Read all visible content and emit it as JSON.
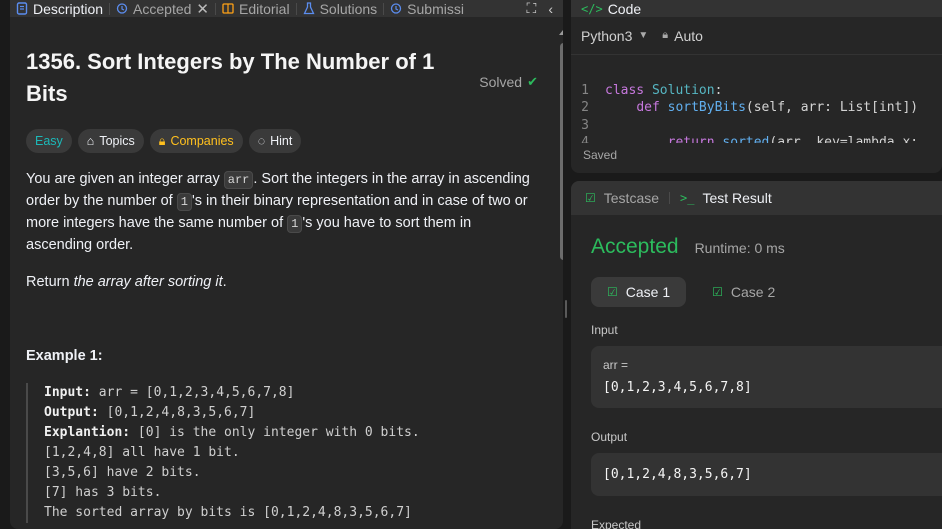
{
  "tabs": [
    {
      "label": "Description",
      "icon": "description-icon",
      "active": true
    },
    {
      "label": "Accepted",
      "icon": "history-icon",
      "active": false
    },
    {
      "label": "Editorial",
      "icon": "book-icon",
      "active": false
    },
    {
      "label": "Solutions",
      "icon": "flask-icon",
      "active": false
    },
    {
      "label": "Submissi",
      "icon": "history-icon",
      "active": false
    }
  ],
  "problem": {
    "title": "1356. Sort Integers by The Number of 1 Bits",
    "status": "Solved",
    "difficulty": "Easy",
    "topics_label": "Topics",
    "companies_label": "Companies",
    "hint_label": "Hint",
    "p1_a": "You are given an integer array ",
    "p1_code1": "arr",
    "p1_b": ". Sort the integers in the array in ascending order by the number of ",
    "p1_code2": "1",
    "p1_c": "'s in their binary representation and in case of two or more integers have the same number of ",
    "p1_code3": "1",
    "p1_d": "'s you have to sort them in ascending order.",
    "p2_a": "Return ",
    "p2_em": "the array after sorting it",
    "p2_b": ".",
    "example_title": "Example 1:",
    "ex_input_label": "Input:",
    "ex_input": " arr = [0,1,2,3,4,5,6,7,8]",
    "ex_output_label": "Output:",
    "ex_output": " [0,1,2,4,8,3,5,6,7]",
    "ex_expl_label": "Explantion:",
    "ex_expl": " [0] is the only integer with 0 bits.",
    "ex_l2": "[1,2,4,8] all have 1 bit.",
    "ex_l3": "[3,5,6] have 2 bits.",
    "ex_l4": "[7] has 3 bits.",
    "ex_l5": "The sorted array by bits is [0,1,2,4,8,3,5,6,7]"
  },
  "editor": {
    "title": "Code",
    "language": "Python3",
    "mode": "Auto",
    "saved": "Saved",
    "line_numbers": [
      "1",
      "2",
      "3",
      "4"
    ]
  },
  "test": {
    "testcase_tab": "Testcase",
    "result_tab": "Test Result",
    "status": "Accepted",
    "runtime": "Runtime: 0 ms",
    "case1": "Case 1",
    "case2": "Case 2",
    "input_label": "Input",
    "var_name": "arr =",
    "input_value": "[0,1,2,3,4,5,6,7,8]",
    "output_label": "Output",
    "output_value": "[0,1,2,4,8,3,5,6,7]",
    "expected_label": "Expected"
  },
  "colors": {
    "accent_green": "#2cbb5d",
    "easy": "#1cb8b8",
    "companies": "#ffc01e",
    "bg": "#1a1a1a",
    "panel": "#262626"
  }
}
